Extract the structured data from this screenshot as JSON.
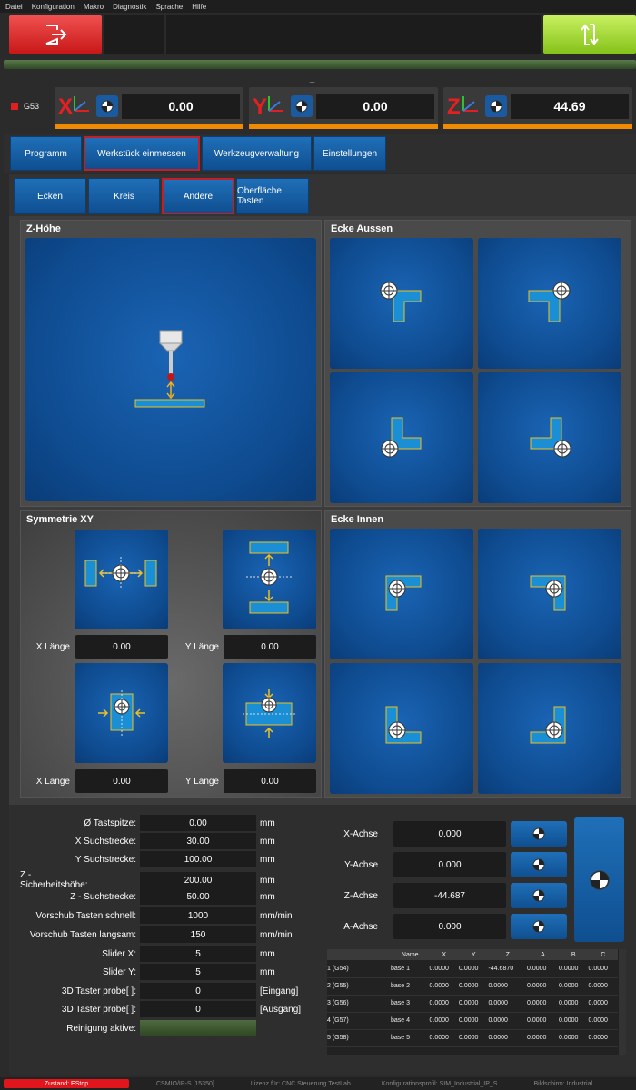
{
  "menu": [
    "Datei",
    "Konfiguration",
    "Makro",
    "Diagnostik",
    "Sprache",
    "Hilfe"
  ],
  "status_label": "G53",
  "axes": [
    {
      "letter": "X",
      "value": "0.00"
    },
    {
      "letter": "Y",
      "value": "0.00"
    },
    {
      "letter": "Z",
      "value": "44.69"
    }
  ],
  "tabs": [
    "Programm",
    "Werkstück einmessen",
    "Werkzeugverwaltung",
    "Einstellungen"
  ],
  "subtabs": [
    "Ecken",
    "Kreis",
    "Andere",
    "Oberfläche Tasten"
  ],
  "panels": {
    "z_hoehe": "Z-Höhe",
    "ecke_aussen": "Ecke Aussen",
    "symmetrie": "Symmetrie XY",
    "ecke_innen": "Ecke Innen"
  },
  "symmetry_fields": [
    {
      "label": "X Länge",
      "value": "0.00"
    },
    {
      "label": "Y Länge",
      "value": "0.00"
    },
    {
      "label": "X Länge",
      "value": "0.00"
    },
    {
      "label": "Y Länge",
      "value": "0.00"
    }
  ],
  "params": [
    {
      "label": "Ø Tastspitze:",
      "value": "0.00",
      "unit": "mm"
    },
    {
      "label": "X Suchstrecke:",
      "value": "30.00",
      "unit": "mm"
    },
    {
      "label": "Y Suchstrecke:",
      "value": "100.00",
      "unit": "mm"
    },
    {
      "label": "Z - Sicherheitshöhe:",
      "value": "200.00",
      "unit": "mm"
    },
    {
      "label": "Z - Suchstrecke:",
      "value": "50.00",
      "unit": "mm"
    },
    {
      "label": "Vorschub Tasten schnell:",
      "value": "1000",
      "unit": "mm/min"
    },
    {
      "label": "Vorschub Tasten langsam:",
      "value": "150",
      "unit": "mm/min"
    },
    {
      "label": "Slider X:",
      "value": "5",
      "unit": "mm"
    },
    {
      "label": "Slider Y:",
      "value": "5",
      "unit": "mm"
    },
    {
      "label": "3D Taster probe[ ]:",
      "value": "0",
      "unit": "[Eingang]"
    },
    {
      "label": "3D Taster probe[ ]:",
      "value": "0",
      "unit": "[Ausgang]"
    }
  ],
  "reinigung_label": "Reinigung aktive:",
  "axis_probe": [
    {
      "label": "X-Achse",
      "value": "0.000"
    },
    {
      "label": "Y-Achse",
      "value": "0.000"
    },
    {
      "label": "Z-Achse",
      "value": "-44.687"
    },
    {
      "label": "A-Achse",
      "value": "0.000"
    }
  ],
  "table": {
    "headers": [
      "Name",
      "X",
      "Y",
      "Z",
      "A",
      "B",
      "C"
    ],
    "rows": [
      {
        "idx": "1 (G54)",
        "cells": [
          "base 1",
          "0.0000",
          "0.0000",
          "-44.6870",
          "0.0000",
          "0.0000",
          "0.0000"
        ]
      },
      {
        "idx": "2 (G55)",
        "cells": [
          "base 2",
          "0.0000",
          "0.0000",
          "0.0000",
          "0.0000",
          "0.0000",
          "0.0000"
        ]
      },
      {
        "idx": "3 (G56)",
        "cells": [
          "base 3",
          "0.0000",
          "0.0000",
          "0.0000",
          "0.0000",
          "0.0000",
          "0.0000"
        ]
      },
      {
        "idx": "4 (G57)",
        "cells": [
          "base 4",
          "0.0000",
          "0.0000",
          "0.0000",
          "0.0000",
          "0.0000",
          "0.0000"
        ]
      },
      {
        "idx": "5 (G58)",
        "cells": [
          "base 5",
          "0.0000",
          "0.0000",
          "0.0000",
          "0.0000",
          "0.0000",
          "0.0000"
        ]
      }
    ]
  },
  "statusbar": {
    "state": "Zustand: EStop",
    "items": [
      "CSMIO/IP-S [15350]",
      "Lizenz für: CNC Steuerung TestLab",
      "Konfigurationsprofil: SIM_Industrial_IP_S",
      "Bildschirm: Industrial"
    ]
  },
  "colors": {
    "accent_red": "#e42020",
    "tile_blue": "#0e4a8e",
    "orange": "#f08a00",
    "green": "#9ad23a"
  }
}
